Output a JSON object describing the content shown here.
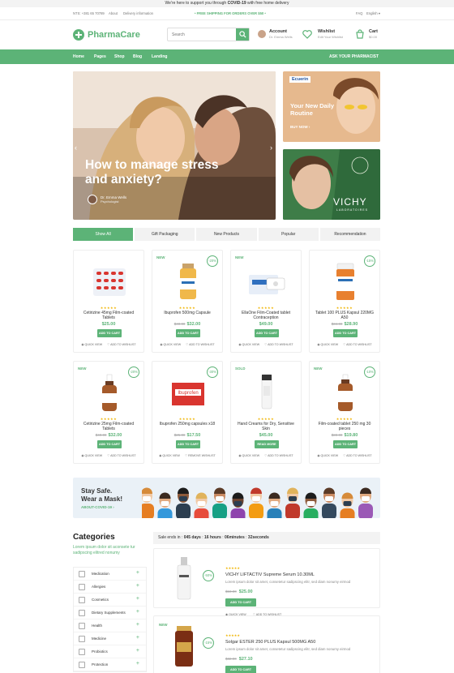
{
  "announcement": {
    "prefix": "We're here to support you through ",
    "highlight": "COVID-19",
    "suffix": " with free home delivery"
  },
  "info_bar": {
    "phone": "NTS: +381 65 70789",
    "about": "About",
    "delivery": "Delivery information",
    "shipping": "• FREE SHIPPING FOR ORDERS OVER $50 •",
    "faq": "FAQ",
    "lang": "English ▾"
  },
  "header": {
    "logo": "PharmaCare",
    "search_placeholder": "Search",
    "account_label": "Account",
    "account_user": "Dr. Emma Wells",
    "wishlist_label": "Wishlist",
    "wishlist_sub": "Edit Your Wishlist",
    "cart_label": "Cart",
    "cart_total": "$0.00"
  },
  "nav": {
    "items": [
      "Home",
      "Pages",
      "Shop",
      "Blog",
      "Landing"
    ],
    "cta": "ASK YOUR PHARMACIST"
  },
  "hero": {
    "title": "How to manage stress and anxiety?",
    "author": "Dr. Emma Wells",
    "author_role": "Psychologist",
    "prev": "‹",
    "next": "›"
  },
  "promos": [
    {
      "brand": "Ecuerin",
      "title": "Your New Daily Routine",
      "cta": "BUY NOW ›"
    },
    {
      "brand": "VICHY",
      "sub": "LABORATOIRES"
    }
  ],
  "tabs": [
    "Show All",
    "Gift Packaging",
    "New Products",
    "Popular",
    "Recommendation"
  ],
  "product_actions": {
    "add": "ADD TO CART",
    "read": "READ MORE",
    "quick": "QUICK VIEW",
    "wish": "ADD TO WISHLIST",
    "remove": "REMOVE WISHLIST"
  },
  "products": [
    {
      "badge": "",
      "disc": "",
      "name": "Cetirizine 45mg Film-coated Tablets",
      "old": "",
      "price": "$25.00",
      "btn": "ADD TO CART"
    },
    {
      "badge": "NEW",
      "disc": "-20%",
      "name": "Ibuprofen 500mg Capsule",
      "old": "$40.00",
      "price": "$32.00",
      "btn": "ADD TO CART"
    },
    {
      "badge": "NEW",
      "disc": "",
      "name": "EllaOne Film-Coated tablet Contraception",
      "old": "",
      "price": "$49.00",
      "btn": "ADD TO CART"
    },
    {
      "badge": "",
      "disc": "-15%",
      "name": "Tablet 100 PLUS Kapsul 220MG A50",
      "old": "$34.00",
      "price": "$28.90",
      "btn": "ADD TO CART"
    },
    {
      "badge": "NEW",
      "disc": "-20%",
      "name": "Cetirizine 25mg Film-coated Tablets",
      "old": "$40.00",
      "price": "$32.00",
      "btn": "ADD TO CART"
    },
    {
      "badge": "",
      "disc": "-30%",
      "name": "Ibuprofen 250mg capsules x18",
      "old": "$25.00",
      "price": "$17.50",
      "btn": "ADD TO CART"
    },
    {
      "badge": "SOLD",
      "disc": "",
      "name": "Hand Creams for Dry, Sensitive Skin",
      "old": "",
      "price": "$45.00",
      "btn": "READ MORE"
    },
    {
      "badge": "NEW",
      "disc": "-10%",
      "name": "Film-coated tablet 250 mg 30 pieces",
      "old": "$22.00",
      "price": "$19.80",
      "btn": "ADD TO CART"
    }
  ],
  "mask_banner": {
    "line1": "Stay Safe.",
    "line2": "Wear a Mask!",
    "link": "ABOUT-COVID-19 ›"
  },
  "categories": {
    "title": "Categories",
    "desc": "Lorem ipsum dolor sit aconsete tur sadipscing elitred nonumy",
    "items": [
      "Medication",
      "Allergies",
      "Cosmetics",
      "Dietary Supplements",
      "Health",
      "Medicine",
      "Probiotics",
      "Protection"
    ]
  },
  "sale": {
    "label": "Sale ends in : ",
    "days": "045 days",
    "hours": "16 hours",
    "minutes": "06minutes",
    "seconds": "32seconds",
    "items": [
      {
        "badge": "",
        "disc": "-50%",
        "name": "VICHY LIFTACTIV Supreme Serum 10.30ML",
        "desc": "Lorem ipsum dolor sit amet, consetetur sadipscing elitr, sed diam nonumy eirmod",
        "old": "$50.00",
        "price": "$25.00",
        "btn": "ADD TO CART"
      },
      {
        "badge": "NEW",
        "disc": "-15%",
        "name": "Solgar ESTER 250 PLUS Kapsul 500MG A50",
        "desc": "Lorem ipsum dolor sit amet, consetetur sadipscing elitr, sed diam nonumy eirmod",
        "old": "$32.00",
        "price": "$27.10",
        "btn": "ADD TO CART"
      }
    ]
  },
  "colors": {
    "accent": "#5cb377",
    "star": "#f0b400"
  }
}
